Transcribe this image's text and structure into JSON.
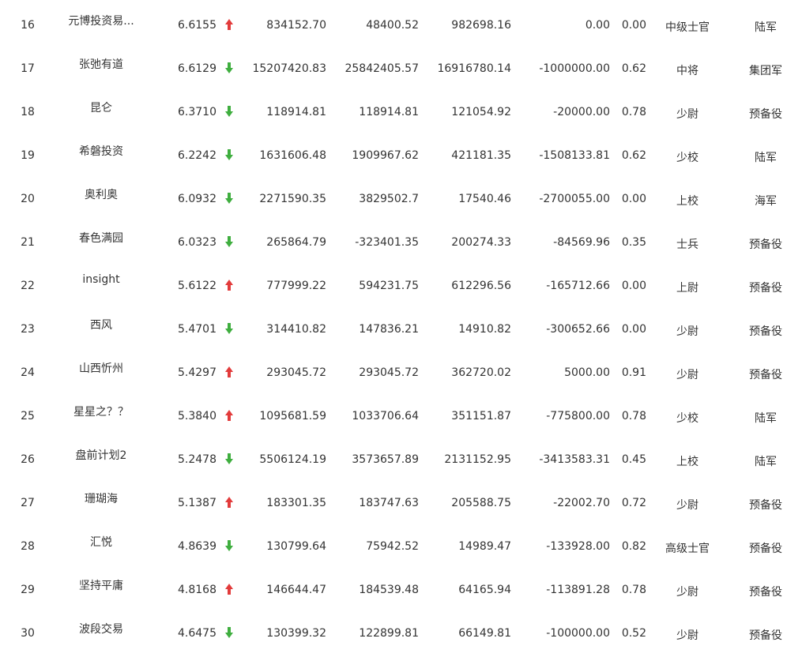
{
  "colors": {
    "up": "#e23b3b",
    "down": "#3fae3f",
    "text": "#333333"
  },
  "rows": [
    {
      "rank": "16",
      "name": "元博投资易...",
      "score": "6.6155",
      "trend": "up",
      "v1": "834152.70",
      "v2": "48400.52",
      "v3": "982698.16",
      "v4": "0.00",
      "ratio": "0.00",
      "title": "中级士官",
      "branch": "陆军"
    },
    {
      "rank": "17",
      "name": "张弛有道",
      "score": "6.6129",
      "trend": "down",
      "v1": "15207420.83",
      "v2": "25842405.57",
      "v3": "16916780.14",
      "v4": "-1000000.00",
      "ratio": "0.62",
      "title": "中将",
      "branch": "集团军"
    },
    {
      "rank": "18",
      "name": "昆仑",
      "score": "6.3710",
      "trend": "down",
      "v1": "118914.81",
      "v2": "118914.81",
      "v3": "121054.92",
      "v4": "-20000.00",
      "ratio": "0.78",
      "title": "少尉",
      "branch": "预备役"
    },
    {
      "rank": "19",
      "name": "希磐投资",
      "score": "6.2242",
      "trend": "down",
      "v1": "1631606.48",
      "v2": "1909967.62",
      "v3": "421181.35",
      "v4": "-1508133.81",
      "ratio": "0.62",
      "title": "少校",
      "branch": "陆军"
    },
    {
      "rank": "20",
      "name": "奥利奥",
      "score": "6.0932",
      "trend": "down",
      "v1": "2271590.35",
      "v2": "3829502.7",
      "v3": "17540.46",
      "v4": "-2700055.00",
      "ratio": "0.00",
      "title": "上校",
      "branch": "海军"
    },
    {
      "rank": "21",
      "name": "春色满园",
      "score": "6.0323",
      "trend": "down",
      "v1": "265864.79",
      "v2": "-323401.35",
      "v3": "200274.33",
      "v4": "-84569.96",
      "ratio": "0.35",
      "title": "士兵",
      "branch": "预备役"
    },
    {
      "rank": "22",
      "name": "insight",
      "score": "5.6122",
      "trend": "up",
      "v1": "777999.22",
      "v2": "594231.75",
      "v3": "612296.56",
      "v4": "-165712.66",
      "ratio": "0.00",
      "title": "上尉",
      "branch": "预备役"
    },
    {
      "rank": "23",
      "name": "西风",
      "score": "5.4701",
      "trend": "down",
      "v1": "314410.82",
      "v2": "147836.21",
      "v3": "14910.82",
      "v4": "-300652.66",
      "ratio": "0.00",
      "title": "少尉",
      "branch": "预备役"
    },
    {
      "rank": "24",
      "name": "山西忻州",
      "score": "5.4297",
      "trend": "up",
      "v1": "293045.72",
      "v2": "293045.72",
      "v3": "362720.02",
      "v4": "5000.00",
      "ratio": "0.91",
      "title": "少尉",
      "branch": "预备役"
    },
    {
      "rank": "25",
      "name": "星星之？？",
      "score": "5.3840",
      "trend": "up",
      "v1": "1095681.59",
      "v2": "1033706.64",
      "v3": "351151.87",
      "v4": "-775800.00",
      "ratio": "0.78",
      "title": "少校",
      "branch": "陆军"
    },
    {
      "rank": "26",
      "name": "盘前计划2",
      "score": "5.2478",
      "trend": "down",
      "v1": "5506124.19",
      "v2": "3573657.89",
      "v3": "2131152.95",
      "v4": "-3413583.31",
      "ratio": "0.45",
      "title": "上校",
      "branch": "陆军"
    },
    {
      "rank": "27",
      "name": "珊瑚海",
      "score": "5.1387",
      "trend": "up",
      "v1": "183301.35",
      "v2": "183747.63",
      "v3": "205588.75",
      "v4": "-22002.70",
      "ratio": "0.72",
      "title": "少尉",
      "branch": "预备役"
    },
    {
      "rank": "28",
      "name": "汇悦",
      "score": "4.8639",
      "trend": "down",
      "v1": "130799.64",
      "v2": "75942.52",
      "v3": "14989.47",
      "v4": "-133928.00",
      "ratio": "0.82",
      "title": "高级士官",
      "branch": "预备役"
    },
    {
      "rank": "29",
      "name": "坚持平庸",
      "score": "4.8168",
      "trend": "up",
      "v1": "146644.47",
      "v2": "184539.48",
      "v3": "64165.94",
      "v4": "-113891.28",
      "ratio": "0.78",
      "title": "少尉",
      "branch": "预备役"
    },
    {
      "rank": "30",
      "name": "波段交易",
      "score": "4.6475",
      "trend": "down",
      "v1": "130399.32",
      "v2": "122899.81",
      "v3": "66149.81",
      "v4": "-100000.00",
      "ratio": "0.52",
      "title": "少尉",
      "branch": "预备役"
    }
  ]
}
